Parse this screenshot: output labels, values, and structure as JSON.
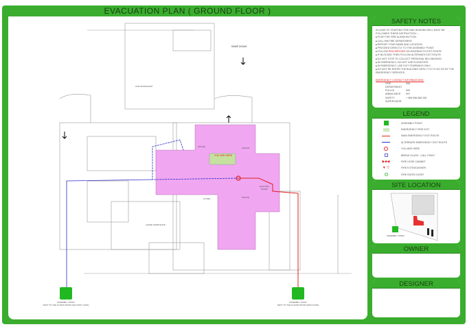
{
  "title": "EVACUATION PLAN ( GROUND FLOOR )",
  "plan": {
    "you_are_here": "YOU ARE HERE",
    "assembly_left": {
      "line1": "ASSEMBLY POINT",
      "line2": "NEXT TO THE GUARD ROOM (FACTORY GATE)"
    },
    "assembly_right": {
      "line1": "ASSEMBLY POINT",
      "line2": "NEXT TO THE GUARD ROOM (MAIN GATE)"
    },
    "ramp_label": "RAMP DOWN",
    "rooms": [
      "OFFICE",
      "OFFICE",
      "OFFICE",
      "ELECTRIC ROOM",
      "HOD WORKSHOP",
      "STORE",
      "LARGE WORKSHOP"
    ]
  },
  "safety_notes": {
    "header": "SAFETY NOTES",
    "intro": "IN CASE OF STARTING FIRE AND HEARING BELL MUST BE FOLLOWED THESE INSTRUCTION :-",
    "items": [
      "PUSH THE FIRE ALARM BUTTON.",
      "CALL 998 FIRE DEPARTMENT.",
      "REPORT YOUR NAME AND LOCATION.",
      "PROCEED DIRECTLY TO THE ASSEMBLY POINT."
    ],
    "red_item": {
      "pre": "FOLLOW ",
      "red": "RED ARROWS",
      "post": " ON DIAGRAM TO EXIT ROUTE."
    },
    "items2": [
      "IF BLOCKED THEN FOLLOW ALTERNATE EXIT ROUTE.",
      "DO NOT STOP TO COLLECT PERSONAL BELONGINGS.",
      "IN EMERGENCY, DO NOT USE ELEVATORS.",
      "IN EMERGENCY, USE EXIT STAIRWAYS ONLY.",
      "DO NOT RE-ENTER THE BUILDING UNTIL IT IS TO DO SO BY THE EMERGENCY SERVICES."
    ],
    "contact_title": "EMERGENCY CONTACT INFORMATIONS:",
    "contacts": [
      {
        "name": "FIRE DEPARTMENT",
        "num": "998"
      },
      {
        "name": "POLICE",
        "num": "999"
      },
      {
        "name": "AMBULANCE",
        "num": "997"
      },
      {
        "name": "SAFETY SUPERVISOR",
        "num": "+ 966 598 566 236"
      }
    ]
  },
  "legend": {
    "header": "LEGEND",
    "items": [
      {
        "icon": "assembly-point-icon",
        "label": "ASSEMBLY POINT"
      },
      {
        "icon": "emergency-exit-icon",
        "label": "EMERGENCY FIRE EXIT"
      },
      {
        "icon": "red-arrow-icon",
        "label": "MAIN EMERGENCY EXIT ROUTE"
      },
      {
        "icon": "blue-arrow-icon",
        "label": "ALTERNATE EMERGENCY EXIT ROUTE"
      },
      {
        "icon": "you-are-here-icon",
        "label": "YOU ARE HERE"
      },
      {
        "icon": "call-point-icon",
        "label": "BREAK GLASS - CALL POINT"
      },
      {
        "icon": "fire-hose-icon",
        "label": "FIRE HOSE CABINET"
      },
      {
        "icon": "extinguisher-icon",
        "label": "FIRE EXTINGUISHER"
      },
      {
        "icon": "fire-door-icon",
        "label": "FIRE RATED DOOR"
      }
    ]
  },
  "site": {
    "header": "SITE LOCATION",
    "assembly": "ASSEMBLY POINT"
  },
  "owner": {
    "header": "OWNER"
  },
  "designer": {
    "header": "DESIGNER"
  },
  "colors": {
    "green": "#3aad2e",
    "pink": "#f0a6f0",
    "red": "#e02020",
    "blue": "#2a2ad0"
  }
}
